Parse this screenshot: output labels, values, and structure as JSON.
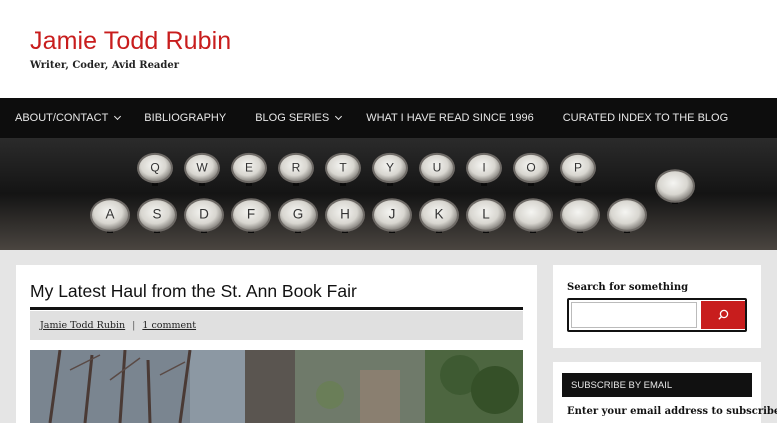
{
  "site": {
    "title": "Jamie Todd Rubin",
    "description": "Writer, Coder, Avid Reader",
    "accent_color": "#c81d1d"
  },
  "nav": {
    "items": [
      {
        "label": "ABOUT/CONTACT",
        "has_dropdown": true
      },
      {
        "label": "BIBLIOGRAPHY",
        "has_dropdown": false
      },
      {
        "label": "BLOG SERIES",
        "has_dropdown": true
      },
      {
        "label": "WHAT I HAVE READ SINCE 1996",
        "has_dropdown": false
      },
      {
        "label": "CURATED INDEX TO THE BLOG",
        "has_dropdown": false
      }
    ]
  },
  "banner": {
    "image": "typewriter-keys",
    "row1_keys": [
      "Q",
      "W",
      "E",
      "R",
      "T",
      "Y",
      "U",
      "I",
      "O",
      "P"
    ],
    "row2_keys": [
      "A",
      "S",
      "D",
      "F",
      "G",
      "H",
      "J",
      "K",
      "L"
    ]
  },
  "post": {
    "title": "My Latest Haul from the St. Ann Book Fair",
    "author": "Jamie Todd Rubin",
    "separator": "|",
    "comments": "1 comment",
    "image": "photo-trees-window"
  },
  "sidebar": {
    "search": {
      "title": "Search for something",
      "placeholder": "",
      "button_icon": "search-icon"
    },
    "subscribe": {
      "header": "SUBSCRIBE BY EMAIL",
      "text": "Enter your email address to subscribe"
    }
  }
}
